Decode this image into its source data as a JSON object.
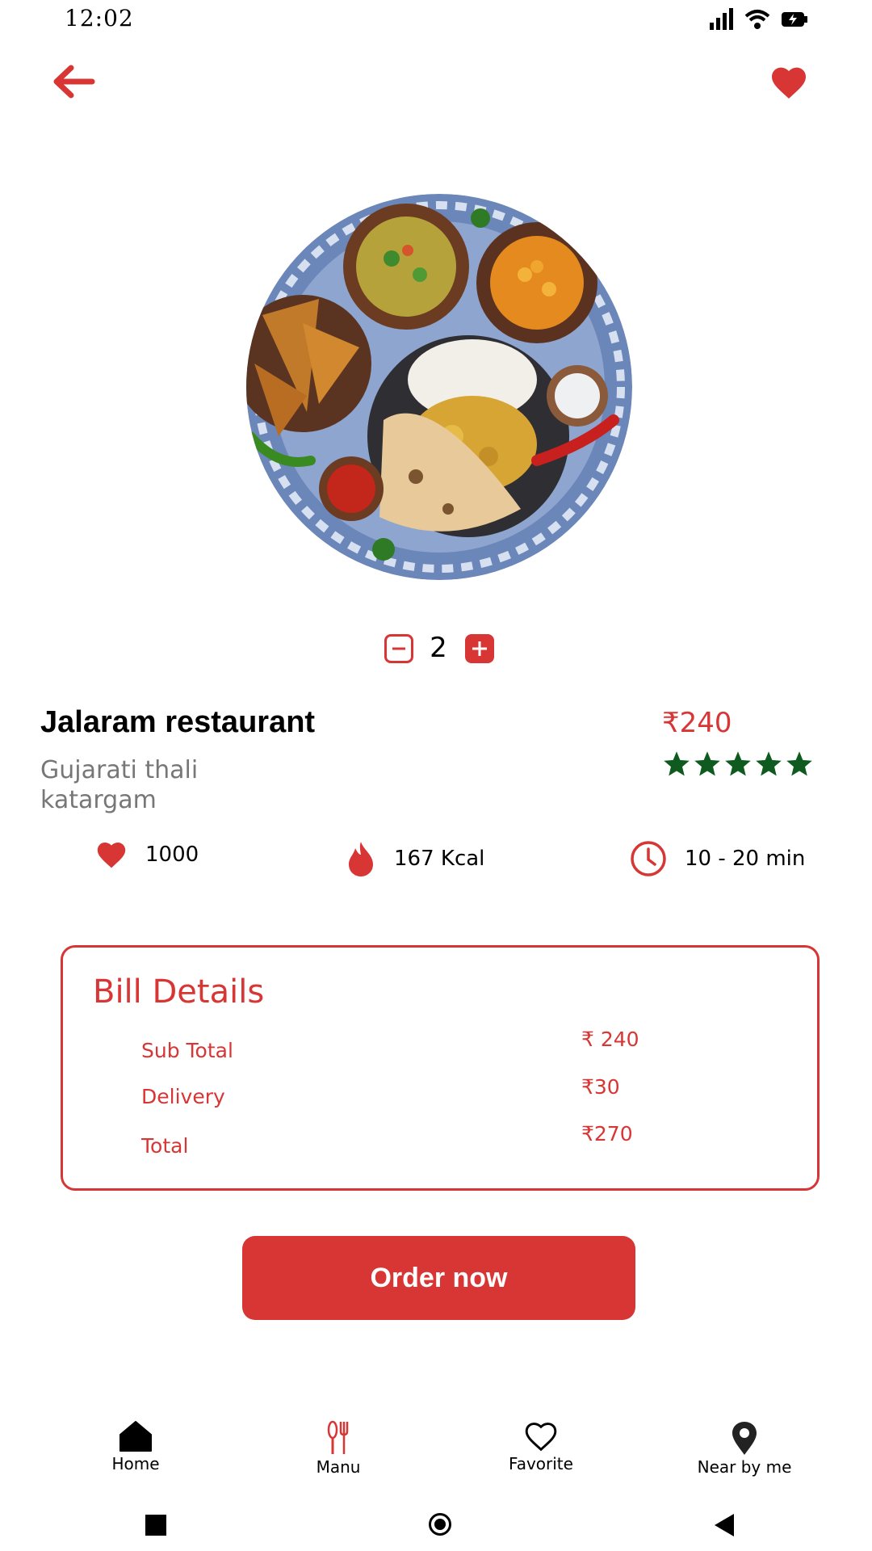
{
  "status_bar": {
    "time": "12:02"
  },
  "header": {
    "back_icon": "back-arrow-icon",
    "favorite_icon": "heart-icon"
  },
  "quantity": {
    "value": "2"
  },
  "restaurant": {
    "name": "Jalaram restaurant",
    "dish": "Gujarati thali",
    "location": "katargam",
    "price": "₹240",
    "rating": 5
  },
  "stats": {
    "likes": "1000",
    "calories": "167 Kcal",
    "time": "10 - 20 min"
  },
  "bill": {
    "title": "Bill Details",
    "rows": [
      {
        "label": "Sub Total",
        "value": "₹ 240"
      },
      {
        "label": "Delivery",
        "value": "₹30"
      },
      {
        "label": "Total",
        "value": "₹270"
      }
    ]
  },
  "order_button": {
    "label": "Order now"
  },
  "bottom_nav": {
    "items": [
      {
        "label": "Home",
        "icon": "home-icon"
      },
      {
        "label": "Manu",
        "icon": "cutlery-icon"
      },
      {
        "label": "Favorite",
        "icon": "heart-outline-icon"
      },
      {
        "label": "Near by me",
        "icon": "location-pin-icon"
      }
    ]
  },
  "colors": {
    "accent": "#d83535",
    "star": "#0f5a1e"
  }
}
